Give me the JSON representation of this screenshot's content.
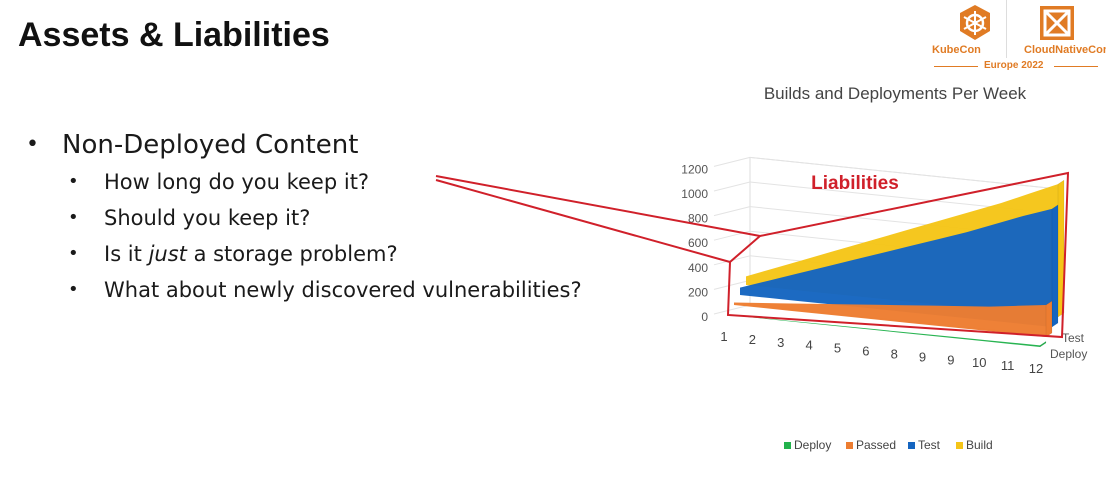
{
  "slide": {
    "title": "Assets & Liabilities"
  },
  "logo": {
    "kubecon": "KubeCon",
    "cloudnativecon": "CloudNativeCon",
    "event": "Europe 2022",
    "accent_color": "#e07b24"
  },
  "bullets": {
    "main": "Non-Deployed Content",
    "sub": [
      {
        "parts": [
          {
            "text": "How long do you keep it?",
            "italic": false
          }
        ]
      },
      {
        "parts": [
          {
            "text": "Should you keep it?",
            "italic": false
          }
        ]
      },
      {
        "parts": [
          {
            "text": "Is it ",
            "italic": false
          },
          {
            "text": "just",
            "italic": true
          },
          {
            "text": " a storage problem?",
            "italic": false
          }
        ]
      },
      {
        "parts": [
          {
            "text": "What about newly discovered vulnerabilities?",
            "italic": false
          }
        ]
      }
    ]
  },
  "chart_data": {
    "type": "area",
    "title": "Builds and Deployments Per Week",
    "x": [
      1,
      2,
      3,
      4,
      5,
      6,
      7,
      8,
      9,
      10,
      11,
      12
    ],
    "x_tick_labels": [
      "1",
      "2",
      "3",
      "4",
      "5",
      "6",
      "8",
      "9",
      "9",
      "10",
      "11",
      "12"
    ],
    "ylim": [
      0,
      1200
    ],
    "y_ticks": [
      0,
      200,
      400,
      600,
      800,
      1000,
      1200
    ],
    "depth_labels": [
      "Test",
      "Deploy"
    ],
    "legend_position": "bottom",
    "series": [
      {
        "name": "Deploy",
        "color": "#22b24c",
        "values": [
          2,
          3,
          4,
          5,
          6,
          7,
          8,
          9,
          10,
          11,
          12,
          13
        ]
      },
      {
        "name": "Passed",
        "color": "#ed7d31",
        "values": [
          20,
          40,
          60,
          80,
          100,
          120,
          140,
          160,
          180,
          200,
          230,
          260
        ]
      },
      {
        "name": "Test",
        "color": "#1565c0",
        "values": [
          60,
          140,
          220,
          300,
          380,
          460,
          540,
          620,
          700,
          790,
          880,
          960
        ]
      },
      {
        "name": "Build",
        "color": "#f5c518",
        "values": [
          70,
          160,
          250,
          340,
          430,
          520,
          610,
          700,
          790,
          880,
          980,
          1080
        ]
      }
    ],
    "annotation": {
      "text": "Liabilities",
      "color": "#d0202a"
    }
  }
}
